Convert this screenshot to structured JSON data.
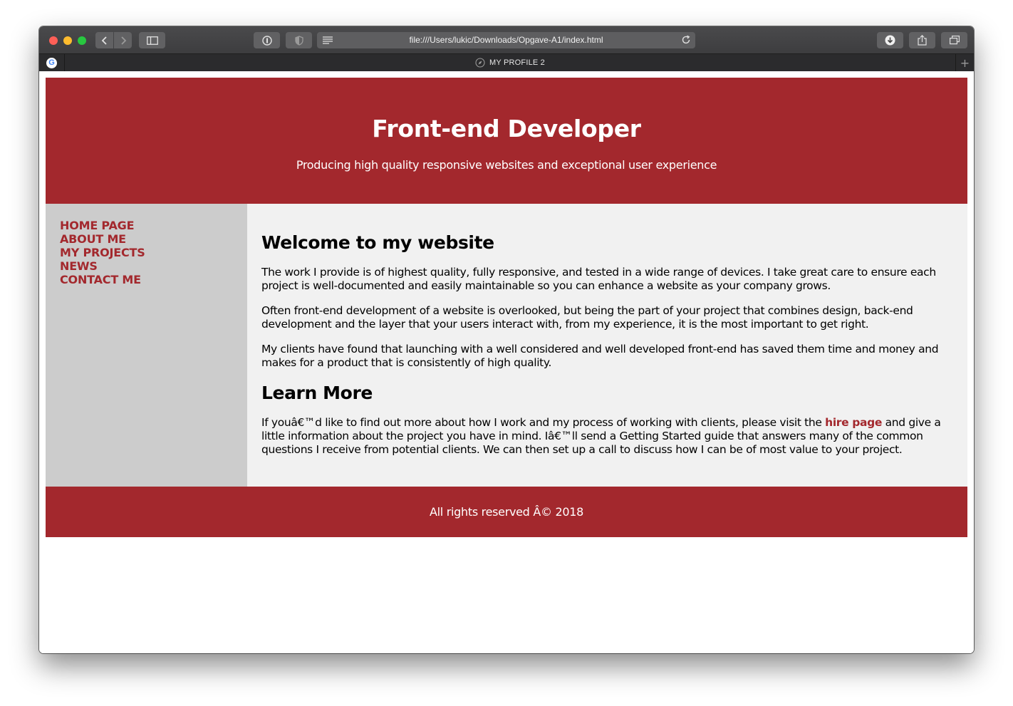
{
  "browser": {
    "url": "file:///Users/lukic/Downloads/Opgave-A1/index.html",
    "tab_title": "MY PROFILE 2",
    "new_tab_glyph": "+"
  },
  "colors": {
    "brand_red": "#a3282d",
    "sidebar_bg": "#cccccc",
    "content_bg": "#f1f1f1"
  },
  "header": {
    "title": "Front-end Developer",
    "subtitle": "Producing high quality responsive websites and exceptional user experience"
  },
  "nav": {
    "items": [
      {
        "label": "HOME PAGE"
      },
      {
        "label": "ABOUT ME"
      },
      {
        "label": "MY PROJECTS"
      },
      {
        "label": "NEWS"
      },
      {
        "label": "CONTACT ME"
      }
    ]
  },
  "main": {
    "heading": "Welcome to my website",
    "paragraphs": [
      "The work I provide is of highest quality, fully responsive, and tested in a wide range of devices. I take great care to ensure each project is well-documented and easily maintainable so you can enhance a website as your company grows.",
      "Often front-end development of a website is overlooked, but being the part of your project that combines design, back-end development and the layer that your users interact with, from my experience, it is the most important to get right.",
      "My clients have found that launching with a well considered and well developed front-end has saved them time and money and makes for a product that is consistently of high quality."
    ],
    "learn_heading": "Learn More",
    "learn_before": "If youâ€™d like to find out more about how I work and my process of working with clients, please visit the ",
    "learn_link": "hire page",
    "learn_after": " and give a little information about the project you have in mind. Iâ€™ll send a Getting Started guide that answers many of the common questions I receive from potential clients. We can then set up a call to discuss how I can be of most value to your project."
  },
  "footer": {
    "text": "All rights reserved Â© 2018"
  }
}
